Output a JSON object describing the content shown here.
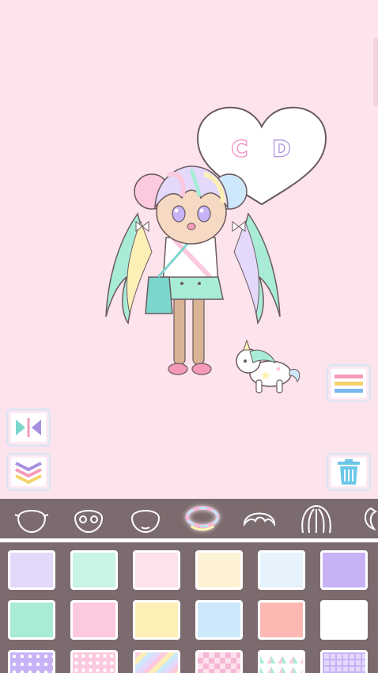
{
  "speech_bubble": {
    "letter_left": "C",
    "letter_right": "D"
  },
  "side_buttons": {
    "flip": "flip-icon",
    "layer_down": "layer-down-icon",
    "menu": "menu-icon",
    "trash": "trash-icon"
  },
  "categories": [
    {
      "icon": "face-shape-icon",
      "active": false
    },
    {
      "icon": "eyes-icon",
      "active": false
    },
    {
      "icon": "head-icon",
      "active": false
    },
    {
      "icon": "halo-icon",
      "active": true
    },
    {
      "icon": "bangs-icon",
      "active": false
    },
    {
      "icon": "long-hair-icon",
      "active": false
    },
    {
      "icon": "hair-accessory-icon",
      "active": false
    }
  ],
  "colors": {
    "background": "#fde3ec",
    "panel": "#7c6b6e",
    "row1": [
      "#e4d9fb",
      "#c8f4e4",
      "#fde1ec",
      "#fdf3d4",
      "#e6f3fd",
      "#c8b2f6"
    ],
    "row2": [
      "#a8ecd8",
      "#fcc9de",
      "#fdf0b6",
      "#cde8fb",
      "#fcb9b4",
      "#ffffff"
    ],
    "row3": [
      "pattern-purple-dots",
      "pattern-pink-dots",
      "pattern-pastel-stripes",
      "pattern-pink-argyle",
      "pattern-pastel-triangles",
      "pattern-lilac-check"
    ]
  }
}
